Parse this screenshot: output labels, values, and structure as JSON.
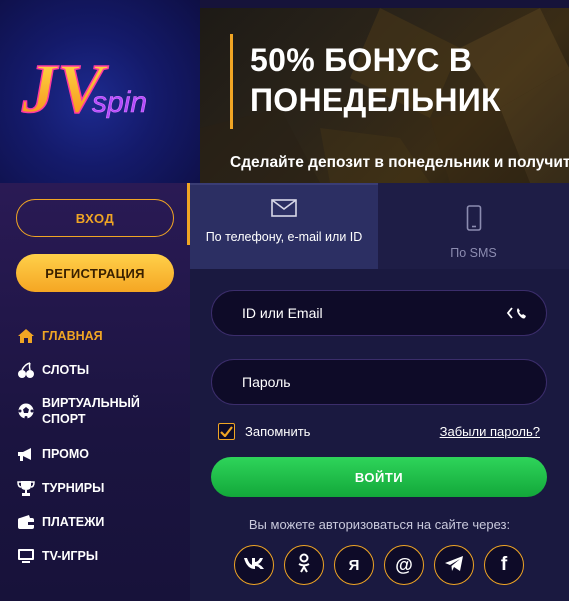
{
  "logo": {
    "text_main": "JV",
    "text_sub": "spin"
  },
  "banner": {
    "title": "50% БОНУС В ПОНЕДЕЛЬНИК",
    "subtitle": "Сделайте депозит в понедельник и получите"
  },
  "sidebar": {
    "login_label": "ВХОД",
    "register_label": "РЕГИСТРАЦИЯ",
    "items": [
      {
        "label": "ГЛАВНАЯ",
        "icon": "home-icon",
        "active": true
      },
      {
        "label": "СЛОТЫ",
        "icon": "cherries-icon",
        "active": false
      },
      {
        "label": "ВИРТУАЛЬНЫЙ СПОРТ",
        "icon": "soccer-ball-icon",
        "active": false
      },
      {
        "label": "ПРОМО",
        "icon": "megaphone-icon",
        "active": false
      },
      {
        "label": "ТУРНИРЫ",
        "icon": "trophy-icon",
        "active": false
      },
      {
        "label": "ПЛАТЕЖИ",
        "icon": "wallet-icon",
        "active": false
      },
      {
        "label": "TV-ИГРЫ",
        "icon": "tv-icon",
        "active": false
      }
    ]
  },
  "login": {
    "tabs": [
      {
        "label": "По телефону, e-mail или ID",
        "icon": "envelope-icon",
        "active": true
      },
      {
        "label": "По SMS",
        "icon": "smartphone-icon",
        "active": false
      }
    ],
    "id_placeholder": "ID или Email",
    "password_placeholder": "Пароль",
    "remember_label": "Запомнить",
    "remember_checked": true,
    "forgot_label": "Забыли пароль?",
    "submit_label": "ВОЙТИ",
    "social_text": "Вы можете авторизоваться на сайте через:",
    "socials": [
      {
        "name": "vk-icon",
        "glyph": "vk"
      },
      {
        "name": "odnoklassniki-icon",
        "glyph": "ok"
      },
      {
        "name": "yandex-icon",
        "glyph": "Я"
      },
      {
        "name": "mailru-icon",
        "glyph": "@"
      },
      {
        "name": "telegram-icon",
        "glyph": "tg"
      },
      {
        "name": "facebook-icon",
        "glyph": "f"
      }
    ]
  },
  "colors": {
    "accent": "#f0a524",
    "green_button": "#1fbf48",
    "panel_bg": "#1a1940",
    "sidebar_bg": "#1b1440"
  }
}
